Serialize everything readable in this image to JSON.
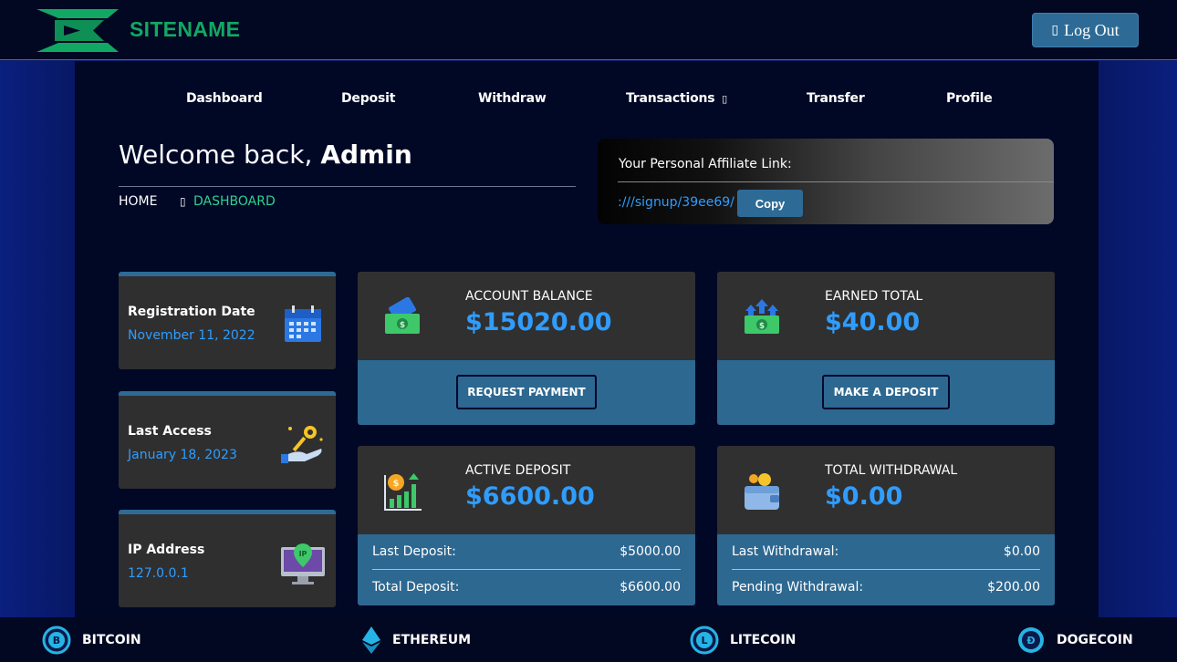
{
  "header": {
    "site_name": "SITENAME",
    "logout_icon": "sign-out-icon",
    "logout_label": "Log Out"
  },
  "nav": {
    "items": [
      {
        "label": "Dashboard"
      },
      {
        "label": "Deposit"
      },
      {
        "label": "Withdraw"
      },
      {
        "label": "Transactions"
      },
      {
        "label": "Transfer"
      },
      {
        "label": "Profile"
      }
    ]
  },
  "welcome": {
    "greeting": "Welcome back,",
    "user": "Admin"
  },
  "breadcrumb": {
    "home": "HOME",
    "current": "DASHBOARD"
  },
  "affiliate": {
    "title": "Your Personal Affiliate Link:",
    "link": ":///signup/39ee69/",
    "copy_label": "Copy"
  },
  "info_cards": [
    {
      "label": "Registration Date",
      "value": "November 11, 2022",
      "icon": "calendar-icon"
    },
    {
      "label": "Last Access",
      "value": "January 18, 2023",
      "icon": "key-hand-icon"
    },
    {
      "label": "IP Address",
      "value": "127.0.0.1",
      "icon": "ip-monitor-icon"
    }
  ],
  "stats": {
    "account_balance": {
      "label": "ACCOUNT BALANCE",
      "value": "$15020.00",
      "button": "REQUEST PAYMENT",
      "icon": "wallet-cash-icon"
    },
    "earned_total": {
      "label": "EARNED TOTAL",
      "value": "$40.00",
      "button": "MAKE A DEPOSIT",
      "icon": "cash-growth-icon"
    },
    "active_deposit": {
      "label": "ACTIVE DEPOSIT",
      "value": "$6600.00",
      "icon": "chart-coin-icon",
      "rows": [
        {
          "k": "Last Deposit:",
          "v": "$5000.00"
        },
        {
          "k": "Total Deposit:",
          "v": "$6600.00"
        }
      ]
    },
    "total_withdrawal": {
      "label": "TOTAL WITHDRAWAL",
      "value": "$0.00",
      "icon": "wallet-coins-icon",
      "rows": [
        {
          "k": "Last Withdrawal:",
          "v": "$0.00"
        },
        {
          "k": "Pending Withdrawal:",
          "v": "$200.00"
        }
      ]
    }
  },
  "coins": [
    {
      "label": "BITCOIN",
      "icon": "bitcoin-icon"
    },
    {
      "label": "ETHEREUM",
      "icon": "ethereum-icon"
    },
    {
      "label": "LITECOIN",
      "icon": "litecoin-icon"
    },
    {
      "label": "DOGECOIN",
      "icon": "dogecoin-icon"
    }
  ],
  "colors": {
    "accent_blue": "#2f9dff",
    "button_blue": "#2d6b96",
    "brand_green": "#11a864",
    "breadcrumb_green": "#2ed18e"
  }
}
